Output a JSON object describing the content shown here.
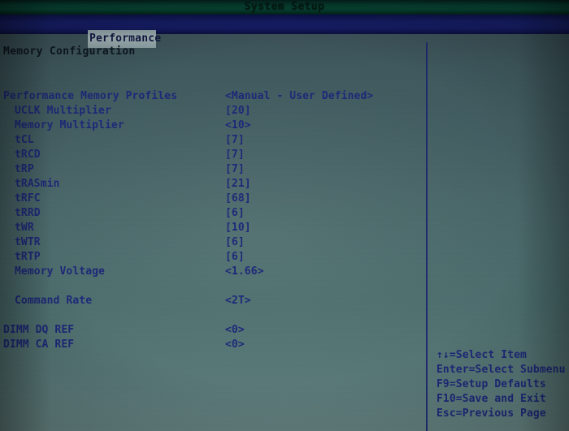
{
  "window": {
    "title": "System Setup"
  },
  "tabs": [
    {
      "label": "Performance",
      "active": true
    }
  ],
  "section": {
    "title": "Memory Configuration"
  },
  "settings": [
    {
      "label": "Performance Memory Profiles",
      "value": "<Manual - User Defined>",
      "indent": false,
      "gap_before": false
    },
    {
      "label": "UCLK Multiplier",
      "value": "[20]",
      "indent": true,
      "gap_before": false
    },
    {
      "label": "Memory Multiplier",
      "value": "<10>",
      "indent": true,
      "gap_before": false
    },
    {
      "label": "tCL",
      "value": "[7]",
      "indent": true,
      "gap_before": false
    },
    {
      "label": "tRCD",
      "value": "[7]",
      "indent": true,
      "gap_before": false
    },
    {
      "label": "tRP",
      "value": "[7]",
      "indent": true,
      "gap_before": false
    },
    {
      "label": "tRASmin",
      "value": "[21]",
      "indent": true,
      "gap_before": false
    },
    {
      "label": "tRFC",
      "value": "[68]",
      "indent": true,
      "gap_before": false
    },
    {
      "label": "tRRD",
      "value": "[6]",
      "indent": true,
      "gap_before": false
    },
    {
      "label": "tWR",
      "value": "[10]",
      "indent": true,
      "gap_before": false
    },
    {
      "label": "tWTR",
      "value": "[6]",
      "indent": true,
      "gap_before": false
    },
    {
      "label": "tRTP",
      "value": "[6]",
      "indent": true,
      "gap_before": false
    },
    {
      "label": "Memory Voltage",
      "value": "<1.66>",
      "indent": true,
      "gap_before": false
    },
    {
      "label": "Command Rate",
      "value": "<2T>",
      "indent": true,
      "gap_before": true
    },
    {
      "label": "DIMM DQ REF",
      "value": "<0>",
      "indent": false,
      "gap_before": true
    },
    {
      "label": "DIMM CA REF",
      "value": "<0>",
      "indent": false,
      "gap_before": false
    }
  ],
  "help": {
    "lines": [
      "↑↓=Select Item",
      "Enter=Select Submenu",
      "F9=Setup Defaults",
      "F10=Save and Exit",
      "Esc=Previous Page"
    ]
  },
  "colors": {
    "background": "#3d565c",
    "title_bar": "#05402f",
    "tab_bar": "#141c63",
    "tab_active": "#9fb0b2",
    "text": "#1d2878",
    "heading_text": "#0d1620",
    "divider": "#1b2570"
  }
}
